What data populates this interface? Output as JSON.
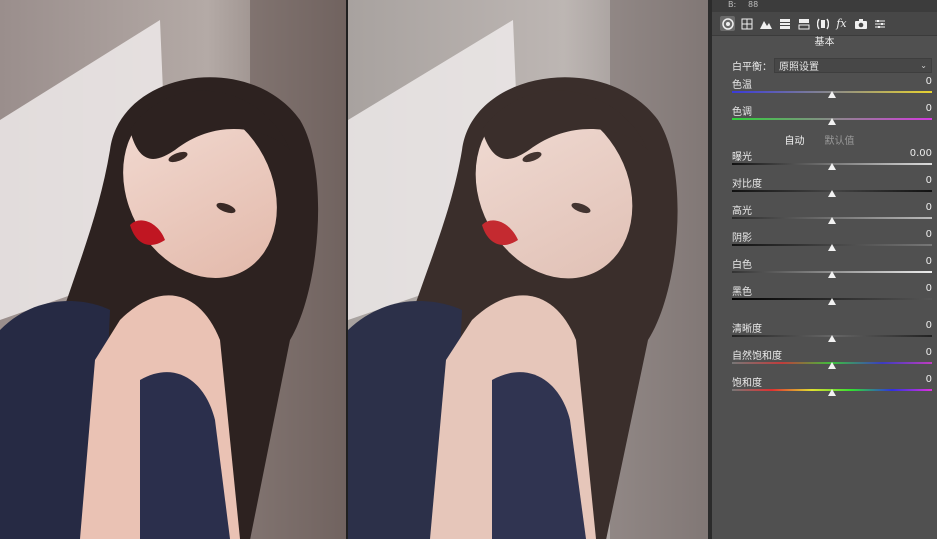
{
  "panel": {
    "top_marks": [
      "B:",
      "88"
    ],
    "section_title": "基本",
    "white_balance": {
      "label": "白平衡：",
      "value": "原照设置"
    },
    "temperature_sliders": [
      {
        "label": "色温",
        "value": "0",
        "fraction": 0.5,
        "track": "linear-gradient(90deg,#3a3ad8,#8a8a8a,#e8d330)"
      },
      {
        "label": "色调",
        "value": "0",
        "fraction": 0.5,
        "track": "linear-gradient(90deg,#2fd23a,#8a8a8a,#d43adf)"
      }
    ],
    "auto_label": "自动",
    "default_label": "默认值",
    "tone_sliders": [
      {
        "label": "曝光",
        "value": "0.00",
        "fraction": 0.5,
        "track": "linear-gradient(90deg,#111,#ddd)"
      },
      {
        "label": "对比度",
        "value": "0",
        "fraction": 0.5,
        "track": "linear-gradient(90deg,#111,#444,#111)"
      },
      {
        "label": "高光",
        "value": "0",
        "fraction": 0.5,
        "track": "linear-gradient(90deg,#2a2a2a,#bbb)"
      },
      {
        "label": "阴影",
        "value": "0",
        "fraction": 0.5,
        "track": "linear-gradient(90deg,#111,#777)"
      },
      {
        "label": "白色",
        "value": "0",
        "fraction": 0.5,
        "track": "linear-gradient(90deg,#333,#eee)"
      },
      {
        "label": "黑色",
        "value": "0",
        "fraction": 0.5,
        "track": "linear-gradient(90deg,#000,#555)"
      }
    ],
    "presence_sliders": [
      {
        "label": "清晰度",
        "value": "0",
        "fraction": 0.5,
        "track": "linear-gradient(90deg,#222,#666,#222)"
      },
      {
        "label": "自然饱和度",
        "value": "0",
        "fraction": 0.5,
        "track": "linear-gradient(90deg,#777,#c03c3c,#3cc03c,#3c3cc0,#c03cc0)"
      },
      {
        "label": "饱和度",
        "value": "0",
        "fraction": 0.5,
        "track": "linear-gradient(90deg,#777,#e03030,#e0e030,#30e030,#3030e0,#e030e0)"
      }
    ]
  },
  "toolbar_icons": [
    "basic-aperture-icon",
    "tone-curve-grid-icon",
    "detail-mountain-icon",
    "hsl-icon",
    "split-toning-icon",
    "lens-corrections-icon",
    "fx-icon",
    "camera-calibration-icon",
    "presets-sliders-icon"
  ]
}
